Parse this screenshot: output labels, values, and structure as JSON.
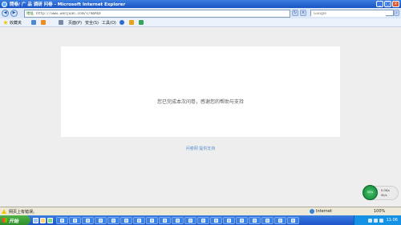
{
  "window": {
    "title": "問卷/ 广 品 调研 问卷 - Microsoft Internet Explorer"
  },
  "address": {
    "label": "地址",
    "url": "http://www.wenjuan.com/s/mUAQF"
  },
  "search": {
    "placeholder": "Google"
  },
  "toolbar": {
    "favorites": "收藏夹",
    "page": "页面(P)",
    "safety": "安全(S)",
    "tools": "工具(O)"
  },
  "content": {
    "message": "您已完成本次问卷，感谢您的帮助与支持",
    "powered_by": "问卷网 提供支持"
  },
  "widget": {
    "ball_text": "50%",
    "rate_up": "0.0K/s",
    "rate_down": "0K/s"
  },
  "status": {
    "text": "网页上有错误。",
    "zone": "Internet",
    "zoom": "100%"
  },
  "taskbar": {
    "start": "开始",
    "clock": "11:06"
  },
  "icons": [
    "ie-icon",
    "back-icon",
    "forward-icon",
    "refresh-icon",
    "stop-icon",
    "search-icon",
    "favorites-icon",
    "home-icon",
    "print-icon",
    "help-icon",
    "warning-icon",
    "globe-icon",
    "windows-flag-icon"
  ]
}
